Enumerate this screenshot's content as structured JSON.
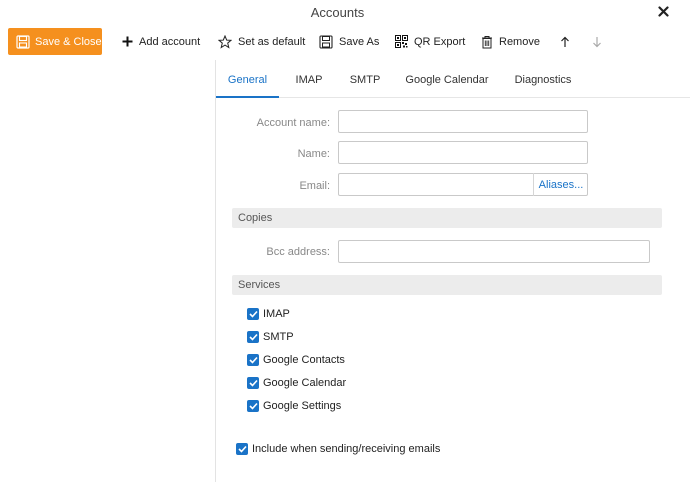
{
  "window": {
    "title": "Accounts"
  },
  "toolbar": {
    "save_close": "Save & Close",
    "add_account": "Add account",
    "set_default": "Set as default",
    "save_as": "Save As",
    "qr_export": "QR Export",
    "remove": "Remove"
  },
  "tabs": [
    "General",
    "IMAP",
    "SMTP",
    "Google Calendar",
    "Diagnostics"
  ],
  "form": {
    "account_name_label": "Account name:",
    "name_label": "Name:",
    "email_label": "Email:",
    "aliases_button": "Aliases...",
    "account_name_value": "",
    "name_value": "",
    "email_value": ""
  },
  "copies": {
    "header": "Copies",
    "bcc_label": "Bcc address:",
    "bcc_value": ""
  },
  "services": {
    "header": "Services",
    "items": [
      {
        "label": "IMAP",
        "checked": true
      },
      {
        "label": "SMTP",
        "checked": true
      },
      {
        "label": "Google Contacts",
        "checked": true
      },
      {
        "label": "Google Calendar",
        "checked": true
      },
      {
        "label": "Google Settings",
        "checked": true
      }
    ]
  },
  "include_option": {
    "label": "Include when sending/receiving emails",
    "checked": true
  },
  "colors": {
    "accent": "#1a73c7",
    "save_button": "#f5901e",
    "section_bg": "#ececec"
  }
}
